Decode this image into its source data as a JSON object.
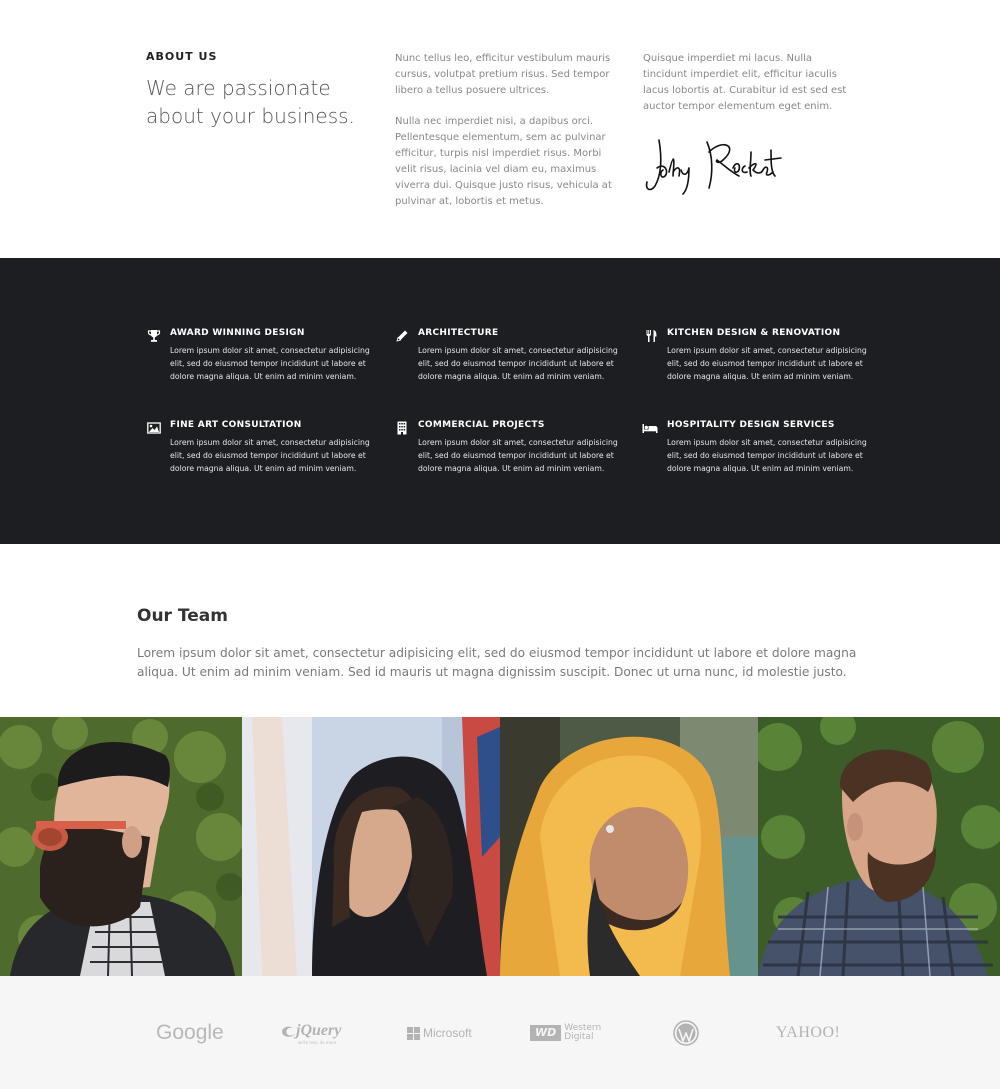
{
  "about": {
    "label": "ABOUT US",
    "heading": "We are passionate about your business.",
    "col2_p1": "Nunc tellus leo, efficitur vestibulum mauris cursus, volutpat pretium risus. Sed tempor libero a tellus posuere ultrices.",
    "col2_p2": "Nulla nec imperdiet nisi, a dapibus orci. Pellentesque elementum, sem ac pulvinar efficitur, turpis nisl imperdiet risus. Morbi velit risus, lacinia vel diam eu, maximus viverra dui. Quisque justo risus, vehicula at pulvinar at, lobortis et metus.",
    "col3_p1": "Quisque imperdiet mi lacus. Nulla tincidunt imperdiet elit, efficitur iaculis lacus lobortis at. Curabitur id est sed est auctor tempor elementum eget enim.",
    "signature": "Johny Rocket"
  },
  "services": [
    {
      "icon": "trophy-icon",
      "title": "AWARD WINNING DESIGN",
      "text": "Lorem ipsum dolor sit amet, consectetur adipisicing elit, sed do eiusmod tempor incididunt ut labore et dolore magna aliqua. Ut enim ad minim veniam."
    },
    {
      "icon": "pencil-icon",
      "title": "ARCHITECTURE",
      "text": "Lorem ipsum dolor sit amet, consectetur adipisicing elit, sed do eiusmod tempor incididunt ut labore et dolore magna aliqua. Ut enim ad minim veniam."
    },
    {
      "icon": "cutlery-icon",
      "title": "KITCHEN DESIGN & RENOVATION",
      "text": "Lorem ipsum dolor sit amet, consectetur adipisicing elit, sed do eiusmod tempor incididunt ut labore et dolore magna aliqua. Ut enim ad minim veniam."
    },
    {
      "icon": "picture-icon",
      "title": "FINE ART CONSULTATION",
      "text": "Lorem ipsum dolor sit amet, consectetur adipisicing elit, sed do eiusmod tempor incididunt ut labore et dolore magna aliqua. Ut enim ad minim veniam."
    },
    {
      "icon": "building-icon",
      "title": "COMMERCIAL PROJECTS",
      "text": "Lorem ipsum dolor sit amet, consectetur adipisicing elit, sed do eiusmod tempor incididunt ut labore et dolore magna aliqua. Ut enim ad minim veniam."
    },
    {
      "icon": "bed-icon",
      "title": "HOSPITALITY DESIGN SERVICES",
      "text": "Lorem ipsum dolor sit amet, consectetur adipisicing elit, sed do eiusmod tempor incididunt ut labore et dolore magna aliqua. Ut enim ad minim veniam."
    }
  ],
  "team": {
    "title": "Our Team",
    "text": "Lorem ipsum dolor sit amet, consectetur adipisicing elit, sed do eiusmod tempor incididunt ut labore et dolore magna aliqua. Ut enim ad minim veniam. Sed id mauris ut magna dignissim suscipit. Donec ut urna nunc, id molestie justo."
  },
  "logos": {
    "google": "Google",
    "jquery": "jQuery",
    "jquery_tagline": "write less, do more.",
    "microsoft": "Microsoft",
    "wd_badge": "WD",
    "wd_line1": "Western",
    "wd_line2": "Digital",
    "wordpress_icon": "wordpress-icon",
    "yahoo": "YAHOO!"
  },
  "colors": {
    "dark_band": "#1d1e22",
    "logo_band": "#f6f6f6",
    "logo_gray": "#b3b3b3"
  }
}
